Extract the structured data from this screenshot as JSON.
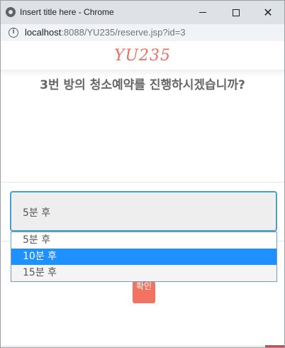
{
  "window": {
    "title": "Insert title here - Chrome",
    "close_glyph": "✕"
  },
  "address": {
    "host": "localhost",
    "path": ":8088/YU235/reserve.jsp?id=3",
    "info_glyph": "i"
  },
  "page": {
    "logo": "YU235",
    "heading": "3번 방의 청소예약를 진행하시겠습니까?"
  },
  "select": {
    "value": "5분 후",
    "options": [
      "5분 후",
      "10분 후",
      "15분 후"
    ],
    "highlighted_index": 1
  },
  "confirm": {
    "label": "확인"
  },
  "colors": {
    "accent": "#f2735f",
    "logo": "#e8705e",
    "highlight": "#1e90ff",
    "focus_border": "#4ba0c4"
  },
  "icons": {
    "app": "chrome-icon",
    "info": "info-icon",
    "minimize": "minimize-icon",
    "maximize": "maximize-icon",
    "close": "close-icon"
  }
}
